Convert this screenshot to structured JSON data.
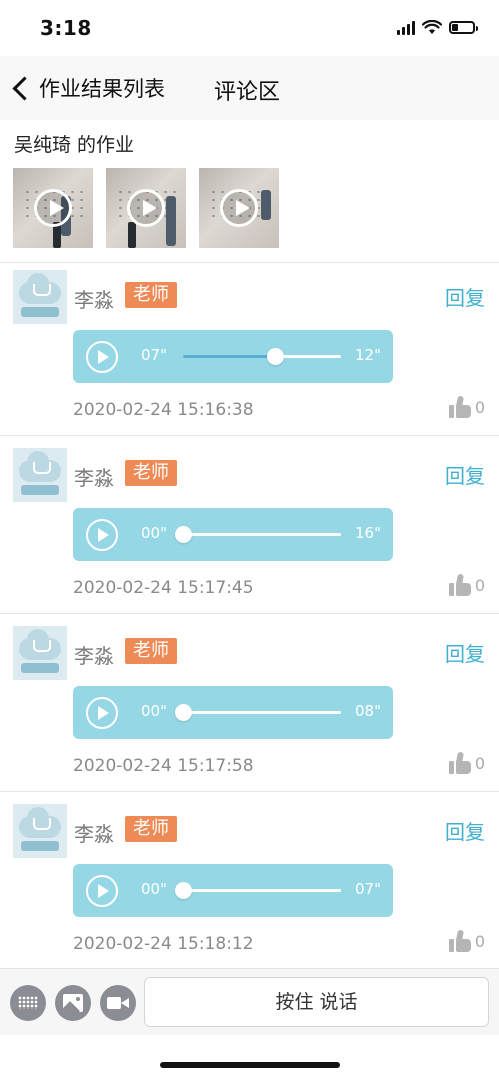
{
  "status_bar": {
    "time": "3:18"
  },
  "nav": {
    "back_label": "作业结果列表",
    "title": "评论区"
  },
  "homework": {
    "title": "吴纯琦 的作业",
    "video_count": 3
  },
  "comments": [
    {
      "author": "李淼",
      "role": "老师",
      "reply": "回复",
      "current": "07\"",
      "total": "12\"",
      "progress": 0.58,
      "time": "2020-02-24 15:16:38",
      "likes": "0"
    },
    {
      "author": "李淼",
      "role": "老师",
      "reply": "回复",
      "current": "00\"",
      "total": "16\"",
      "progress": 0.0,
      "time": "2020-02-24 15:17:45",
      "likes": "0"
    },
    {
      "author": "李淼",
      "role": "老师",
      "reply": "回复",
      "current": "00\"",
      "total": "08\"",
      "progress": 0.0,
      "time": "2020-02-24 15:17:58",
      "likes": "0"
    },
    {
      "author": "李淼",
      "role": "老师",
      "reply": "回复",
      "current": "00\"",
      "total": "07\"",
      "progress": 0.0,
      "time": "2020-02-24 15:18:12",
      "likes": "0"
    }
  ],
  "input_bar": {
    "talk_label": "按住 说话"
  },
  "icons": [
    "signal-icon",
    "wifi-icon",
    "battery-icon",
    "back-chevron-icon",
    "play-icon",
    "thumbs-up-icon",
    "keyboard-icon",
    "image-icon",
    "video-icon"
  ],
  "colors": {
    "accent": "#3fb1cf",
    "audio_bg": "#96d7e6",
    "badge": "#ee8a55"
  }
}
